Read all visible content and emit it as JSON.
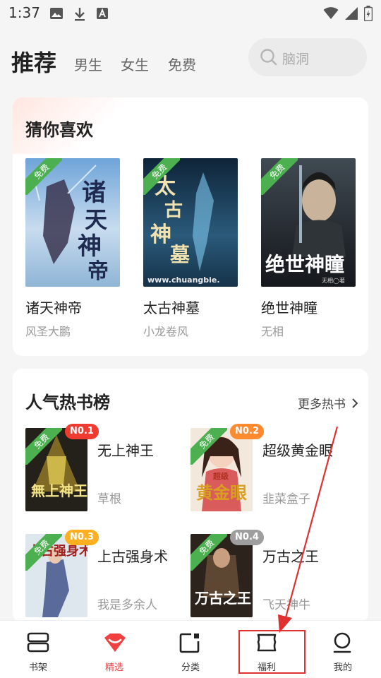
{
  "status_bar": {
    "time": "1:37",
    "left_icons": [
      "image-icon",
      "download-icon",
      "a-box-icon"
    ],
    "right_icons": [
      "wifi-icon",
      "signal-icon",
      "battery-icon"
    ]
  },
  "top_nav": {
    "active_tab": "推荐",
    "tabs": [
      "男生",
      "女生",
      "免费"
    ],
    "search_placeholder": "脑洞"
  },
  "guess_section": {
    "title": "猜你喜欢",
    "free_label": "免费",
    "books": [
      {
        "name": "诸天神帝",
        "author": "风圣大鹏",
        "cover_text": "诸天神帝"
      },
      {
        "name": "太古神墓",
        "author": "小龙卷风",
        "cover_text": "太古神墓",
        "cover_sub": "www.chuangbie."
      },
      {
        "name": "绝世神瞳",
        "author": "无相",
        "cover_text": "绝世神瞳",
        "cover_sub": "无相◯著"
      }
    ]
  },
  "hot_section": {
    "title": "人气热书榜",
    "more_label": "更多热书",
    "free_label": "免费",
    "items": [
      {
        "rank": "N0.1",
        "name": "无上神王",
        "author": "草根",
        "cover_text": "無上神王"
      },
      {
        "rank": "N0.2",
        "name": "超级黄金眼",
        "author": "韭菜盒子",
        "cover_text": "黄金眼",
        "cover_sub": "超级"
      },
      {
        "rank": "N0.3",
        "name": "上古强身术",
        "author": "我是多余人",
        "cover_text": "上古强身术"
      },
      {
        "rank": "N0.4",
        "name": "万古之王",
        "author": "飞天神牛",
        "cover_text": "万古之王"
      }
    ]
  },
  "bottom_nav": {
    "items": [
      {
        "label": "书架",
        "icon": "bookshelf-icon"
      },
      {
        "label": "精选",
        "icon": "featured-icon"
      },
      {
        "label": "分类",
        "icon": "category-icon"
      },
      {
        "label": "福利",
        "icon": "ticket-icon"
      },
      {
        "label": "我的",
        "icon": "profile-icon"
      }
    ],
    "active": "精选"
  },
  "colors": {
    "accent": "#f04040",
    "free_ribbon": "#4caf50",
    "rank1": "#f03c30",
    "rank2": "#ff8a30",
    "rank3": "#ffb020",
    "rank4": "#9e9e9e",
    "annotation": "#e03030"
  }
}
